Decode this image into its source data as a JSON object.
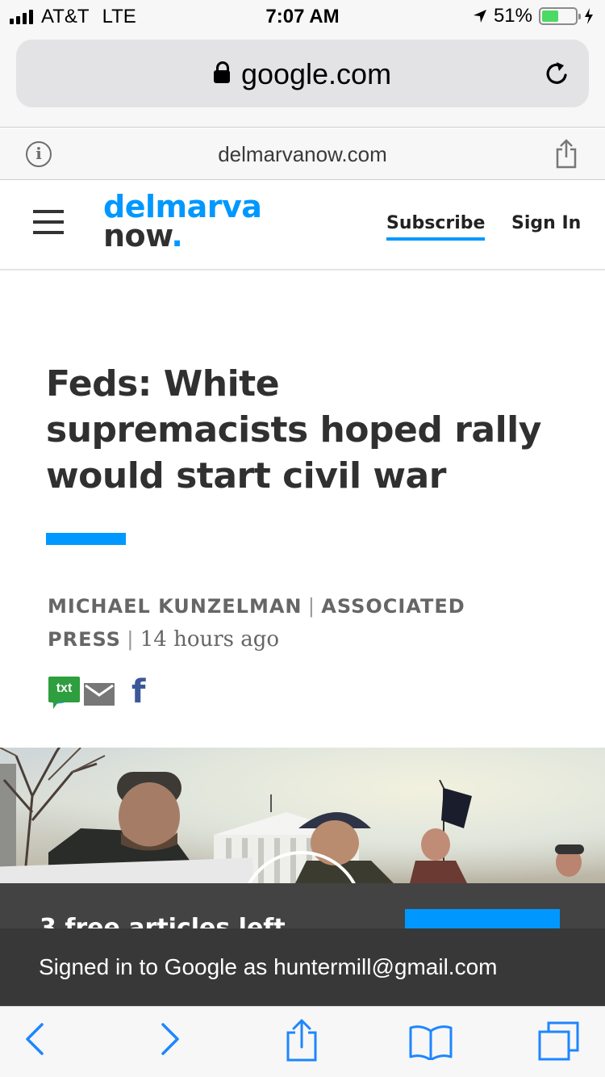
{
  "status_bar": {
    "carrier": "AT&T",
    "network": "LTE",
    "time": "7:07 AM",
    "battery_percent": "51%",
    "battery_level": 0.51,
    "signal_bars": 4
  },
  "browser": {
    "url": "google.com",
    "site_domain": "delmarvanow.com"
  },
  "site": {
    "logo_line1": "delmarva",
    "logo_line2": "now",
    "logo_dot": ".",
    "subscribe_label": "Subscribe",
    "signin_label": "Sign In",
    "brand_color": "#0098fe"
  },
  "article": {
    "headline": "Feds: White supremacists hoped rally would start civil war",
    "author": "MICHAEL KUNZELMAN",
    "source": "ASSOCIATED PRESS",
    "timestamp": "14 hours ago",
    "share_icons": [
      "txt",
      "f"
    ]
  },
  "paywall": {
    "text": "3 free articles left"
  },
  "toast": {
    "text": "Signed in to Google as huntermill@gmail.com"
  },
  "toolbar": {
    "icons": [
      "back-icon",
      "forward-icon",
      "share-icon",
      "bookmarks-icon",
      "tabs-icon"
    ]
  }
}
